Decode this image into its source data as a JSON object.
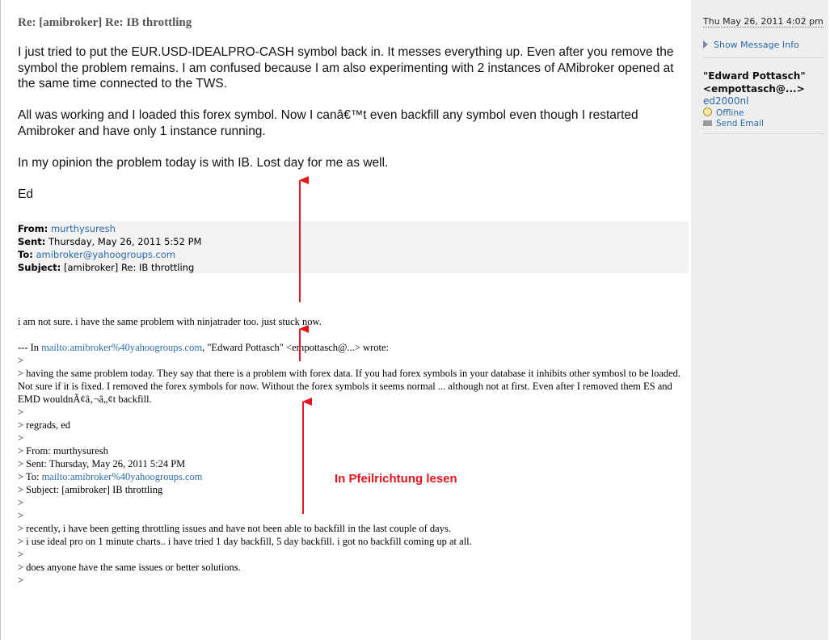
{
  "message": {
    "subject": "Re: [amibroker] Re: IB throttling",
    "body": [
      "I just tried to put the EUR.USD-IDEALPRO-CASH symbol back in. It messes everything up. Even after you remove the symbol the problem remains. I am confused because I am also experimenting with 2 instances of AMibroker opened at the same time connected to the TWS.",
      "All was working and I loaded this forex symbol. Now I canâ€™t even backfill any symbol even though I restarted Amibroker and have only 1 instance running.",
      "In my opinion the problem today is with IB. Lost day for me as well."
    ],
    "signature": "Ed"
  },
  "quote_header": {
    "from_label": "From:",
    "from_value": "murthysuresh",
    "sent_label": "Sent:",
    "sent_value": "Thursday, May 26, 2011 5:52 PM",
    "to_label": "To:",
    "to_value": "amibroker@yahoogroups.com",
    "subject_label": "Subject:",
    "subject_value": "[amibroker] Re: IB throttling"
  },
  "reply": {
    "line1": "i am not sure. i have the same problem with ninjatrader too. just stuck now.",
    "attrib_prefix": "--- In ",
    "attrib_link": "mailto:amibroker%40yahoogroups.com",
    "attrib_suffix": ", \"Edward Pottasch\" <empottasch@...> wrote:",
    "q1": ">",
    "q2": "> having the same problem today. They say that there is a problem with forex data. If you had forex symbols in your database it inhibits other symbosl to be loaded. Not sure if it is fixed. I removed the forex symbols for now. Without the forex symbols it seems normal ... although not at first. Even after I removed them ES and EMD wouldnÃ¢â‚¬â„¢t backfill.",
    "q3": ">",
    "q4": "> regrads, ed",
    "q5": ">",
    "q6": "> From: murthysuresh",
    "q7": "> Sent: Thursday, May 26, 2011 5:24 PM",
    "q8_prefix": "> To: ",
    "q8_link": "mailto:amibroker%40yahoogroups.com",
    "q9": "> Subject: [amibroker] IB throttling",
    "q10": ">",
    "q11": ">",
    "q12": "> recently, i have been getting throttling issues and have not been able to backfill in the last couple of days.",
    "q13": "> i use ideal pro on 1 minute charts.. i have tried 1 day backfill, 5 day backfill. i got no backfill coming up at all.",
    "q14": ">",
    "q15": "> does anyone have the same issues or better solutions.",
    "q16": ">"
  },
  "sidebar": {
    "date": "Thu May 26, 2011 4:02 pm",
    "show_info": "Show Message Info",
    "author_name": "\"Edward Pottasch\"",
    "author_email": "<empottasch@...>",
    "yahoo_id": "ed2000nl",
    "status": "Offline",
    "send_email": "Send Email"
  },
  "annotation": {
    "text": "In Pfeilrichtung lesen",
    "color": "#e8141d"
  },
  "colors": {
    "link": "#2b6aa8",
    "sidebar_bg": "#eeeeee",
    "quote_bg": "#f2f2f2"
  }
}
